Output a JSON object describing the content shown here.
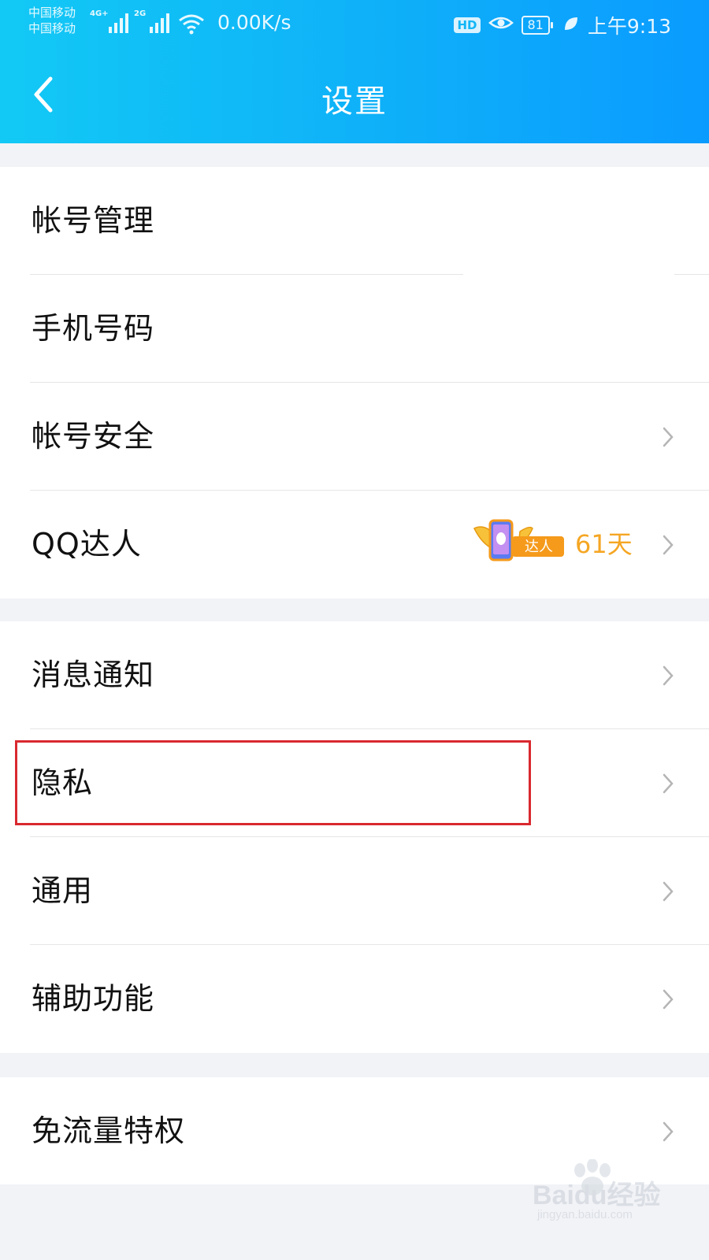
{
  "status_bar": {
    "carrier_1": "中国移动",
    "carrier_2": "中国移动",
    "net_1": "4G+",
    "net_2": "2G",
    "speed": "0.00K/s",
    "hd": "HD",
    "battery": "81",
    "time": "上午9:13"
  },
  "header": {
    "title": "设置",
    "back_icon": "chevron-left-icon",
    "gradient_colors": [
      "#12c9f5",
      "#0a9bff"
    ]
  },
  "groups": [
    {
      "items": [
        {
          "label": "帐号管理",
          "has_chevron": false
        },
        {
          "label": "手机号码",
          "has_chevron": false
        },
        {
          "label": "帐号安全",
          "has_chevron": true
        },
        {
          "label": "QQ达人",
          "has_chevron": true,
          "badge_text": "达人",
          "days": "61天"
        }
      ]
    },
    {
      "items": [
        {
          "label": "消息通知",
          "has_chevron": true
        },
        {
          "label": "隐私",
          "has_chevron": true,
          "highlighted": true
        },
        {
          "label": "通用",
          "has_chevron": true
        },
        {
          "label": "辅助功能",
          "has_chevron": true
        }
      ]
    },
    {
      "items": [
        {
          "label": "免流量特权",
          "has_chevron": true
        }
      ]
    }
  ],
  "watermark": {
    "brand": "Baidu经验",
    "url": "jingyan.baidu.com"
  },
  "colors": {
    "accent": "#0fb2f8",
    "highlight_box": "#d9292f",
    "days_text": "#f5a623",
    "background": "#f2f3f7"
  }
}
